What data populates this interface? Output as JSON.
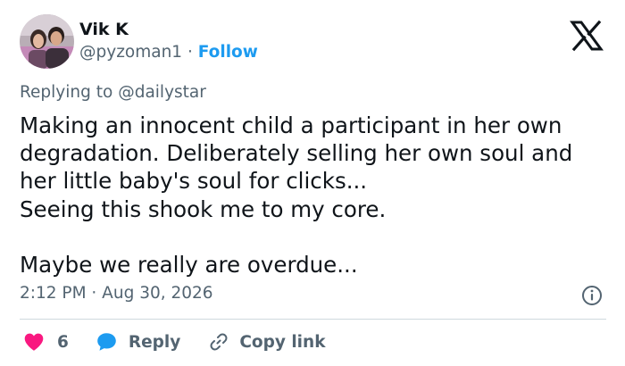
{
  "author": {
    "display_name": "Vik K",
    "handle": "@pyzoman1",
    "separator": "·",
    "follow_label": "Follow",
    "avatar_icon": "profile-photo"
  },
  "brand": {
    "logo_icon": "x-logo-icon"
  },
  "reply_context": {
    "prefix": "Replying to",
    "mention": "@dailystar"
  },
  "tweet": {
    "lines": [
      "Making an innocent child a participant in her own",
      "degradation. Deliberately selling her own soul and",
      "her little baby's soul for clicks...",
      "Seeing this shook me to my core.",
      "",
      "Maybe we really are overdue..."
    ],
    "timestamp": "2:12 PM · Aug 30, 2026"
  },
  "actions": {
    "like_count": "6",
    "reply_label": "Reply",
    "copy_link_label": "Copy link"
  },
  "colors": {
    "accent": "#1d9bf0",
    "like": "#f91880",
    "text_primary": "#0f1419",
    "text_secondary": "#536471",
    "divider": "#cfd9de"
  }
}
